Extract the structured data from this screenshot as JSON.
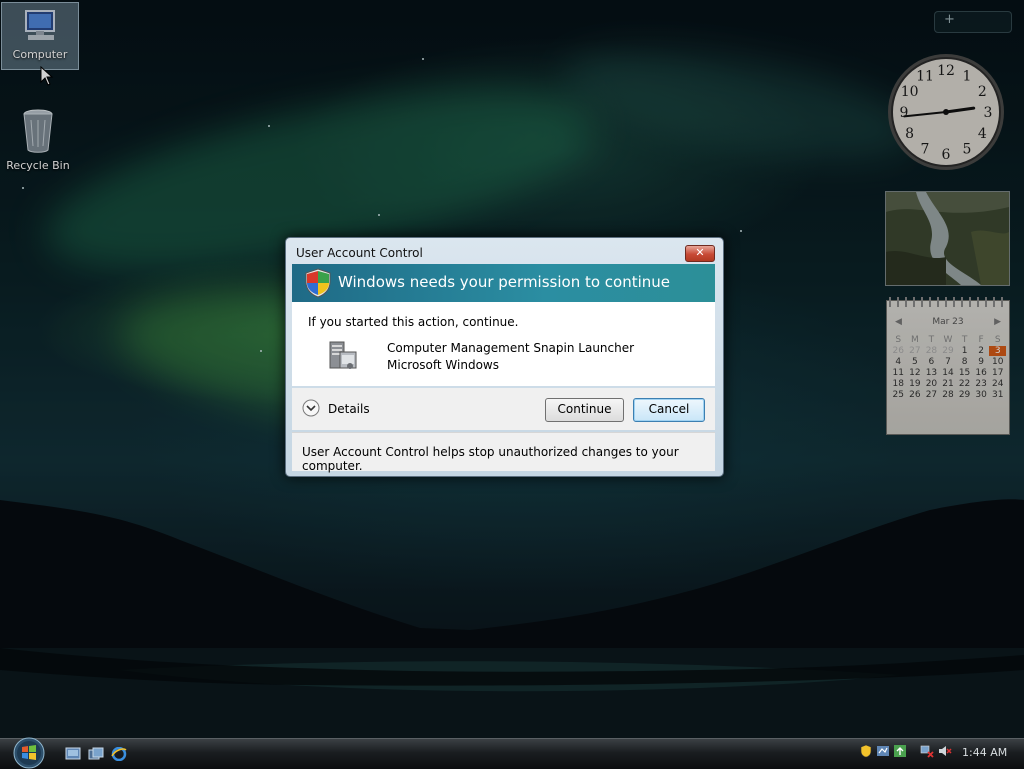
{
  "desktop": {
    "icons": [
      {
        "label": "Computer",
        "selected": true
      },
      {
        "label": "Recycle Bin",
        "selected": false
      }
    ]
  },
  "gadgets": {
    "toolbar_add": "+",
    "clock": {
      "hour": 2,
      "minute": 44,
      "numerals": [
        "12",
        "1",
        "2",
        "3",
        "4",
        "5",
        "6",
        "7",
        "8",
        "9",
        "10",
        "11"
      ]
    },
    "calendar": {
      "month_label": "Mar 23",
      "prev": "◀",
      "next": "▶",
      "weekdays": [
        "S",
        "M",
        "T",
        "W",
        "T",
        "F",
        "S"
      ],
      "weeks": [
        [
          "",
          "",
          "",
          "",
          "1",
          "2",
          "3"
        ],
        [
          "4",
          "5",
          "6",
          "7",
          "8",
          "9",
          "10"
        ],
        [
          "11",
          "12",
          "13",
          "14",
          "15",
          "16",
          "17"
        ],
        [
          "18",
          "19",
          "20",
          "21",
          "22",
          "23",
          "24"
        ],
        [
          "25",
          "26",
          "27",
          "28",
          "29",
          "30",
          "31"
        ]
      ],
      "today": "3",
      "leading_faded": [
        "26",
        "27",
        "28",
        "29"
      ],
      "trailing": [],
      "last_week": [
        "26",
        "27",
        "28",
        "29",
        "30",
        "31"
      ]
    }
  },
  "dialog": {
    "title": "User Account Control",
    "close_label": "✕",
    "banner": "Windows needs your permission to continue",
    "started": "If you started this action, continue.",
    "program_name": "Computer Management Snapin Launcher",
    "publisher": "Microsoft Windows",
    "details_label": "Details",
    "continue_label": "Continue",
    "cancel_label": "Cancel",
    "footer": "User Account Control helps stop unauthorized changes to your computer."
  },
  "taskbar": {
    "clock": "1:44 AM"
  },
  "colors": {
    "banner": "#2b8ea2",
    "calendar_today": "#d45a16",
    "close_button": "#c84a36"
  }
}
